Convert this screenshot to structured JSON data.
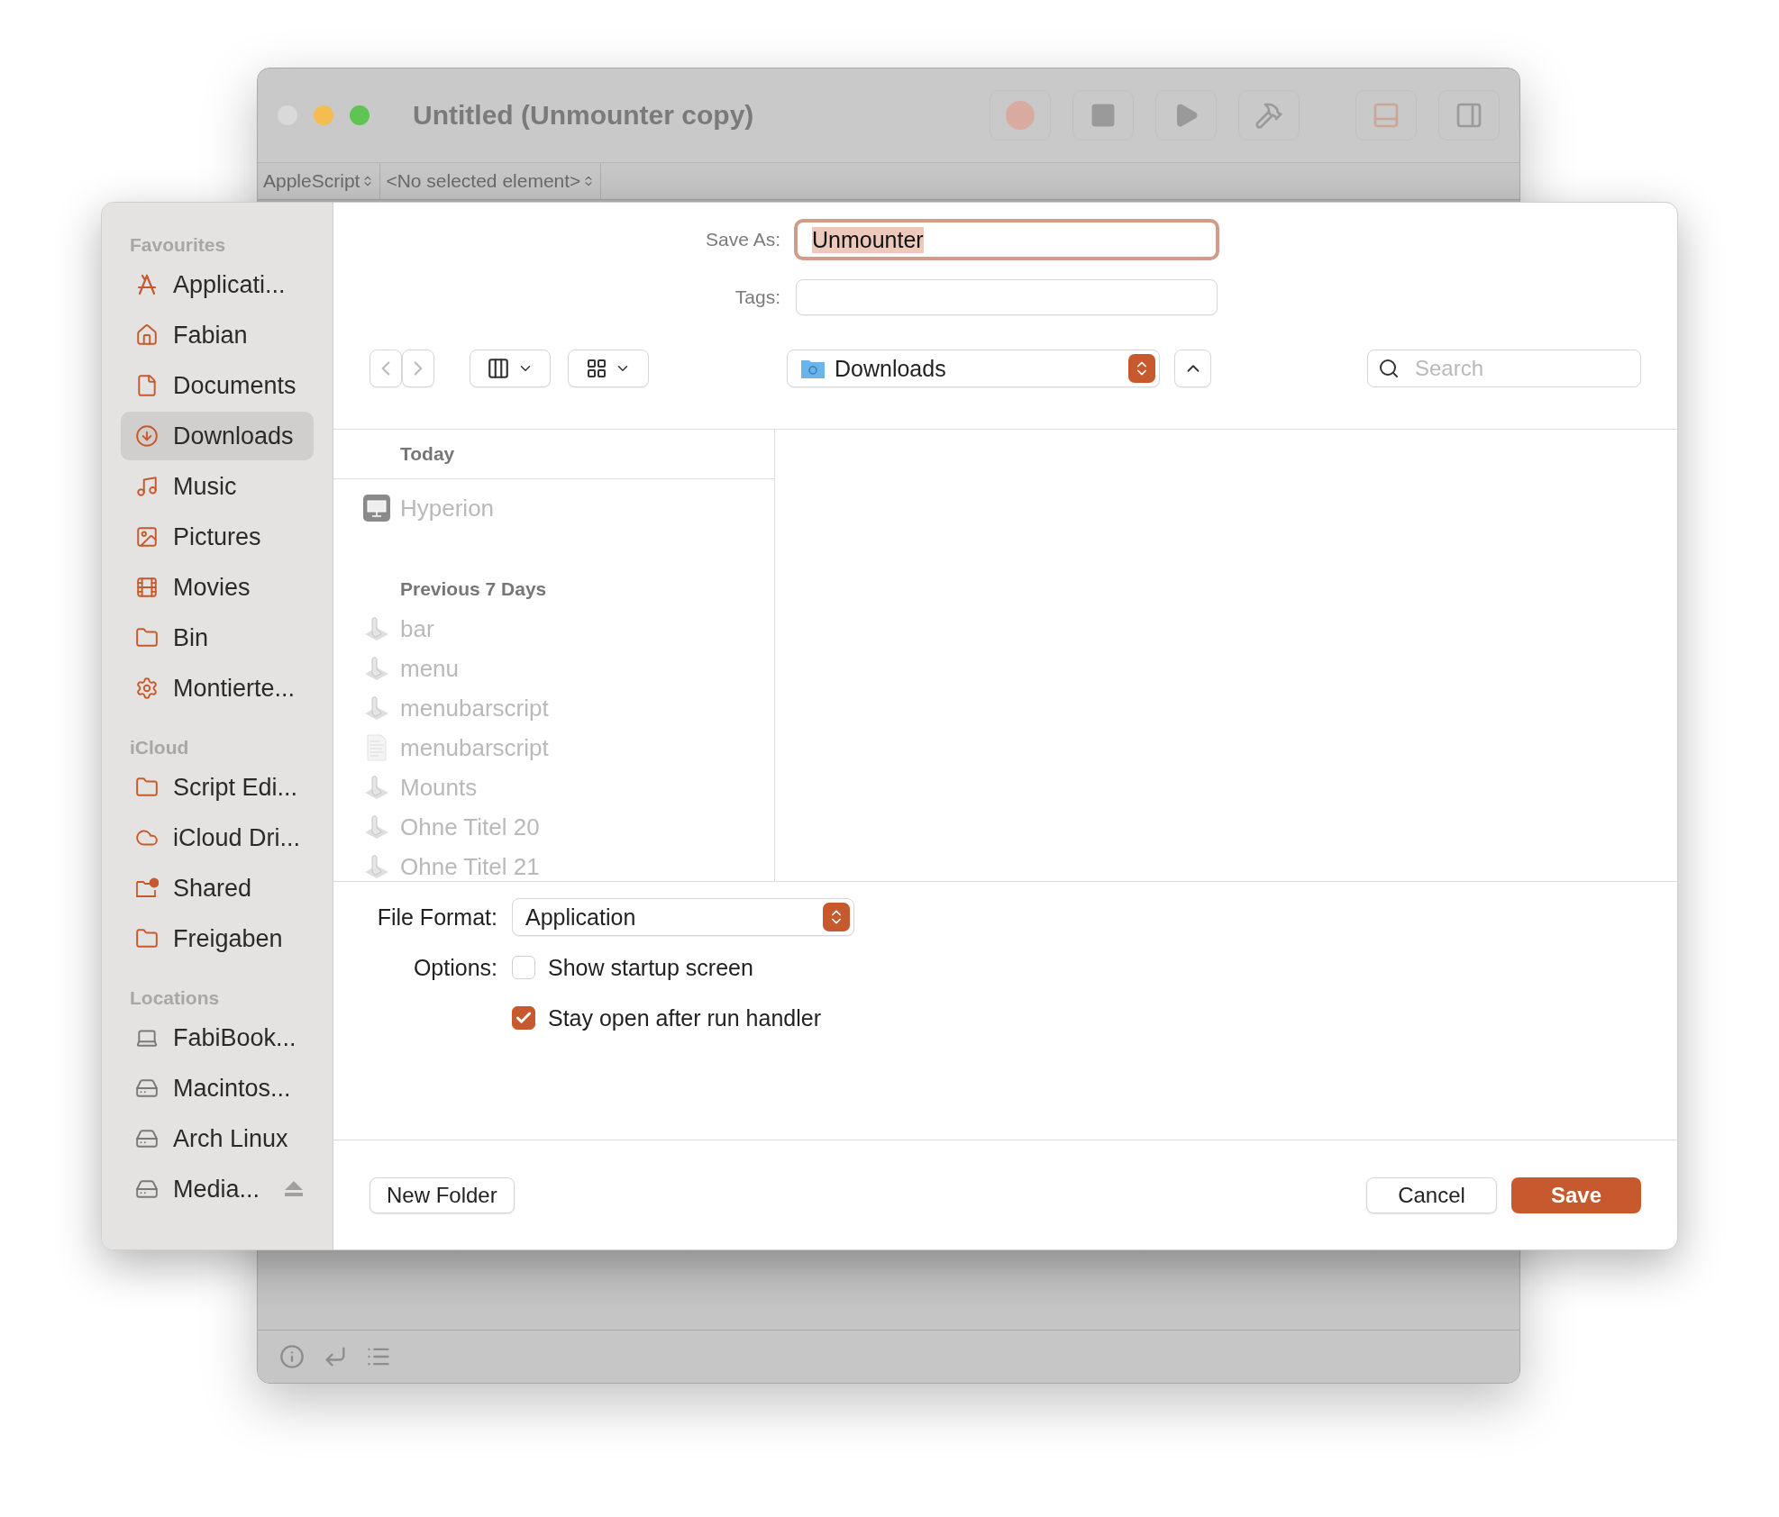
{
  "window": {
    "title": "Untitled (Unmounter copy)",
    "language_popup": "AppleScript",
    "element_popup": "<No selected element>"
  },
  "sidebar": {
    "sections": [
      {
        "title": "Favourites",
        "items": [
          {
            "label": "Applicati...",
            "kind": "apps",
            "selected": false
          },
          {
            "label": "Fabian",
            "kind": "home",
            "selected": false
          },
          {
            "label": "Documents",
            "kind": "document",
            "selected": false
          },
          {
            "label": "Downloads",
            "kind": "download",
            "selected": true
          },
          {
            "label": "Music",
            "kind": "music",
            "selected": false
          },
          {
            "label": "Pictures",
            "kind": "picture",
            "selected": false
          },
          {
            "label": "Movies",
            "kind": "film",
            "selected": false
          },
          {
            "label": "Bin",
            "kind": "folder",
            "selected": false
          },
          {
            "label": "Montierte...",
            "kind": "gear",
            "selected": false
          }
        ]
      },
      {
        "title": "iCloud",
        "items": [
          {
            "label": "Script Edi...",
            "kind": "folder",
            "selected": false
          },
          {
            "label": "iCloud Dri...",
            "kind": "cloud",
            "selected": false
          },
          {
            "label": "Shared",
            "kind": "shared",
            "selected": false
          },
          {
            "label": "Freigaben",
            "kind": "folder",
            "selected": false
          }
        ]
      },
      {
        "title": "Locations",
        "items": [
          {
            "label": "FabiBook...",
            "kind": "laptop",
            "selected": false
          },
          {
            "label": "Macintos...",
            "kind": "disk",
            "selected": false
          },
          {
            "label": "Arch Linux",
            "kind": "disk",
            "selected": false
          },
          {
            "label": "Media...",
            "kind": "eject-disk",
            "selected": false
          }
        ]
      }
    ]
  },
  "save_as": {
    "label": "Save As:",
    "value": "Unmounter"
  },
  "tags": {
    "label": "Tags:"
  },
  "location": "Downloads",
  "search": {
    "placeholder": "Search"
  },
  "file_groups": [
    {
      "title": "Today",
      "items": [
        {
          "name": "Hyperion",
          "kind": "display"
        }
      ]
    },
    {
      "title": "Previous 7 Days",
      "items": [
        {
          "name": "bar",
          "kind": "applet"
        },
        {
          "name": "menu",
          "kind": "applet"
        },
        {
          "name": "menubarscript",
          "kind": "applet"
        },
        {
          "name": "menubarscript",
          "kind": "text"
        },
        {
          "name": "Mounts",
          "kind": "applet"
        },
        {
          "name": "Ohne Titel 20",
          "kind": "applet"
        },
        {
          "name": "Ohne Titel 21",
          "kind": "applet"
        }
      ]
    }
  ],
  "file_format": {
    "label": "File Format:",
    "value": "Application"
  },
  "options": {
    "label": "Options:",
    "items": [
      {
        "label": "Show startup screen",
        "checked": false
      },
      {
        "label": "Stay open after run handler",
        "checked": true
      }
    ]
  },
  "buttons": {
    "new_folder": "New Folder",
    "cancel": "Cancel",
    "save": "Save"
  }
}
